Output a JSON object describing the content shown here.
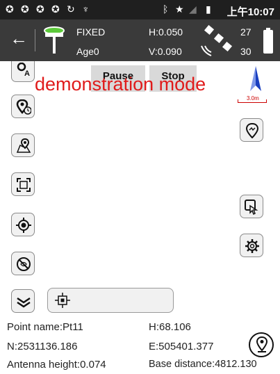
{
  "status_bar": {
    "time": "上午10:07",
    "icons": [
      "notification-icon",
      "notification-icon",
      "notification-icon",
      "notification-icon",
      "sync-icon",
      "usb-icon",
      "bluetooth-icon",
      "star-icon",
      "signal-icon",
      "sim-icon"
    ]
  },
  "header": {
    "fix_status": "FIXED",
    "age": "Age0",
    "h_precision": "H:0.050",
    "v_precision": "V:0.090",
    "satellites_top": "27",
    "satellites_bottom": "30"
  },
  "map": {
    "pause_label": "Pause",
    "stop_label": "Stop",
    "demo_text": "demonstration mode",
    "scale_label": "3.0m",
    "left_tools": [
      "point-label-tool",
      "timed-point-tool",
      "map-point-tool",
      "full-extent-tool",
      "locate-tool",
      "hide-tool",
      "expand-tool"
    ],
    "right_tools": [
      "route-tool",
      "touch-tool",
      "settings-tool"
    ]
  },
  "info": {
    "point_name": "Point name:Pt11",
    "h": "H:68.106",
    "n": "N:2531136.186",
    "e": "E:505401.377",
    "antenna": "Antenna height:0.074",
    "base_distance": "Base distance:4812.130"
  },
  "colors": {
    "header_bg": "#3a3a3a",
    "status_bg": "#1f1f1f",
    "demo_text": "#e01b1b",
    "antenna_green": "#5cc93a",
    "north_arrow": "#1a3fbf"
  }
}
